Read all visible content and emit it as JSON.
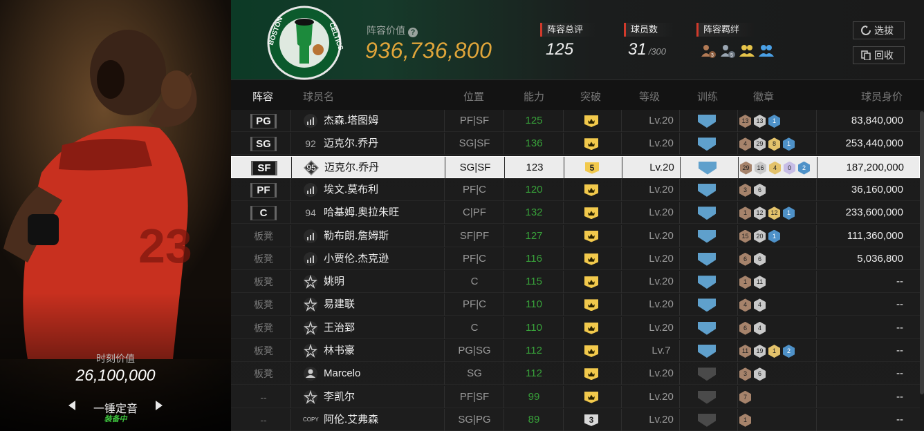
{
  "left_panel": {
    "card_image": "michael-jordan-roaring-card",
    "moment_label": "时刻价值",
    "moment_value": "26,100,000",
    "skill_name": "一锤定音",
    "skill_status": "装备中"
  },
  "team": {
    "logo": "boston-celtics-logo",
    "logo_text": "BOSTON CELTICS",
    "lineup_value_label": "阵容价值",
    "lineup_value": "936,736,800",
    "rating_label": "阵容总评",
    "rating_value": "125",
    "player_count_label": "球员数",
    "player_count": "31",
    "player_capacity": "/300",
    "bonds_label": "阵容羁绊",
    "bond_icons": [
      {
        "icon": "bond-bronze-icon",
        "level": "3",
        "color": "#b27a55"
      },
      {
        "icon": "bond-silver-icon",
        "level": "5",
        "color": "#9aa6b2"
      },
      {
        "icon": "bond-gold-icon",
        "level": "",
        "color": "#e6c44a"
      },
      {
        "icon": "bond-blue-icon",
        "level": "",
        "color": "#4aa0e6"
      }
    ],
    "buttons": {
      "select_label": "选拔",
      "recycle_label": "回收"
    }
  },
  "table": {
    "headers": {
      "lineup": "阵容",
      "name": "球员名",
      "position": "位置",
      "ability": "能力",
      "breakthrough": "突破",
      "level": "等级",
      "training": "训练",
      "badges": "徽章",
      "value": "球员身价"
    },
    "rows": [
      {
        "slot": "PG",
        "starter": true,
        "rank": "",
        "rank_icon": "signal-icon",
        "name": "杰森.塔图姆",
        "pos": "PF|SF",
        "ability": "125",
        "brk": "",
        "lv": "Lv.20",
        "train": true,
        "badges": [
          [
            "br",
            "13"
          ],
          [
            "si",
            "13"
          ],
          [
            "bl",
            "1"
          ]
        ],
        "value": "83,840,000"
      },
      {
        "slot": "SG",
        "starter": true,
        "rank": "92",
        "rank_icon": "",
        "name": "迈克尔.乔丹",
        "pos": "SG|SF",
        "ability": "136",
        "brk": "",
        "lv": "Lv.20",
        "train": true,
        "badges": [
          [
            "br",
            "4"
          ],
          [
            "si",
            "29"
          ],
          [
            "go",
            "8"
          ],
          [
            "bl",
            "1"
          ]
        ],
        "value": "253,440,000"
      },
      {
        "slot": "SF",
        "starter": true,
        "selected": true,
        "rank": "95",
        "rank_icon": "diamond-rank-icon",
        "name": "迈克尔.乔丹",
        "pos": "SG|SF",
        "ability": "123",
        "brk": "5",
        "lv": "Lv.20",
        "train": true,
        "badges": [
          [
            "br",
            "29"
          ],
          [
            "si",
            "16"
          ],
          [
            "go",
            "4"
          ],
          [
            "pu",
            "0"
          ],
          [
            "bl",
            "2"
          ]
        ],
        "value": "187,200,000"
      },
      {
        "slot": "PF",
        "starter": true,
        "rank": "",
        "rank_icon": "signal-icon",
        "name": "埃文.莫布利",
        "pos": "PF|C",
        "ability": "120",
        "brk": "",
        "lv": "Lv.20",
        "train": true,
        "badges": [
          [
            "br",
            "3"
          ],
          [
            "si",
            "6"
          ]
        ],
        "value": "36,160,000"
      },
      {
        "slot": "C",
        "starter": true,
        "rank": "94",
        "rank_icon": "",
        "name": "哈基姆.奥拉朱旺",
        "pos": "C|PF",
        "ability": "132",
        "brk": "",
        "lv": "Lv.20",
        "train": true,
        "badges": [
          [
            "br",
            "1"
          ],
          [
            "si",
            "12"
          ],
          [
            "go",
            "12"
          ],
          [
            "bl",
            "1"
          ]
        ],
        "value": "233,600,000"
      },
      {
        "slot": "板凳",
        "starter": false,
        "rank": "",
        "rank_icon": "signal-icon",
        "name": "勒布朗.詹姆斯",
        "pos": "SF|PF",
        "ability": "127",
        "brk": "",
        "lv": "Lv.20",
        "train": true,
        "badges": [
          [
            "br",
            "15"
          ],
          [
            "si",
            "20"
          ],
          [
            "bl",
            "1"
          ]
        ],
        "value": "111,360,000"
      },
      {
        "slot": "板凳",
        "starter": false,
        "rank": "",
        "rank_icon": "signal-icon",
        "name": "小贾伦.杰克逊",
        "pos": "PF|C",
        "ability": "116",
        "brk": "",
        "lv": "Lv.20",
        "train": true,
        "badges": [
          [
            "br",
            "6"
          ],
          [
            "si",
            "6"
          ]
        ],
        "value": "5,036,800"
      },
      {
        "slot": "板凳",
        "starter": false,
        "rank": "",
        "rank_icon": "star-badge-icon",
        "name": "姚明",
        "pos": "C",
        "ability": "115",
        "brk": "",
        "lv": "Lv.20",
        "train": true,
        "badges": [
          [
            "br",
            "1"
          ],
          [
            "si",
            "11"
          ]
        ],
        "value": "--"
      },
      {
        "slot": "板凳",
        "starter": false,
        "rank": "",
        "rank_icon": "star-badge-icon",
        "name": "易建联",
        "pos": "PF|C",
        "ability": "110",
        "brk": "",
        "lv": "Lv.20",
        "train": true,
        "badges": [
          [
            "br",
            "4"
          ],
          [
            "si",
            "4"
          ]
        ],
        "value": "--"
      },
      {
        "slot": "板凳",
        "starter": false,
        "rank": "",
        "rank_icon": "star-badge-icon",
        "name": "王治郅",
        "pos": "C",
        "ability": "110",
        "brk": "",
        "lv": "Lv.20",
        "train": true,
        "badges": [
          [
            "br",
            "6"
          ],
          [
            "si",
            "4"
          ]
        ],
        "value": "--"
      },
      {
        "slot": "板凳",
        "starter": false,
        "rank": "",
        "rank_icon": "star-badge-icon",
        "name": "林书豪",
        "pos": "PG|SG",
        "ability": "112",
        "brk": "",
        "lv": "Lv.7",
        "train": true,
        "badges": [
          [
            "br",
            "11"
          ],
          [
            "si",
            "19"
          ],
          [
            "go",
            "1"
          ],
          [
            "bl",
            "2"
          ]
        ],
        "value": "--"
      },
      {
        "slot": "板凳",
        "starter": false,
        "rank": "",
        "rank_icon": "person-icon",
        "name": "Marcelo",
        "pos": "SG",
        "ability": "112",
        "brk": "",
        "lv": "Lv.20",
        "train": false,
        "badges": [
          [
            "br",
            "3"
          ],
          [
            "si",
            "6"
          ]
        ],
        "value": "--"
      },
      {
        "slot": "--",
        "starter": false,
        "rank": "",
        "rank_icon": "star-badge-icon",
        "name": "李凯尔",
        "pos": "PF|SF",
        "ability": "99",
        "brk": "",
        "lv": "Lv.20",
        "train": false,
        "badges": [
          [
            "br",
            "7"
          ]
        ],
        "value": "--"
      },
      {
        "slot": "--",
        "starter": false,
        "rank": "",
        "rank_icon": "copy-icon",
        "rank_text": "COPY",
        "name": "阿伦.艾弗森",
        "pos": "SG|PG",
        "ability": "89",
        "brk": "3",
        "brk_grey": true,
        "lv": "Lv.20",
        "train": false,
        "badges": [
          [
            "br",
            "1"
          ]
        ],
        "value": "--"
      }
    ]
  }
}
